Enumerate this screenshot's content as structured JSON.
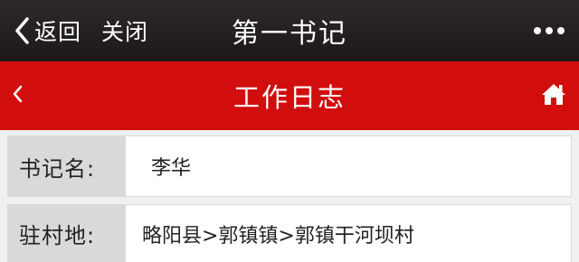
{
  "nav": {
    "back_label": "返回",
    "close_label": "关闭",
    "app_title": "第一书记"
  },
  "header": {
    "title": "工作日志"
  },
  "fields": [
    {
      "label": "书记名:",
      "value": "李华"
    },
    {
      "label": "驻村地:",
      "value": "略阳县>郭镇镇>郭镇干河坝村"
    }
  ],
  "colors": {
    "topbar": "#1f1c1b",
    "header": "#d20d0d",
    "label_bg": "#d9d9d9",
    "page_bg": "#f0f0f0"
  },
  "icons": [
    "back-chevron-icon",
    "more-dots-icon",
    "back-arrow-icon",
    "home-icon"
  ]
}
